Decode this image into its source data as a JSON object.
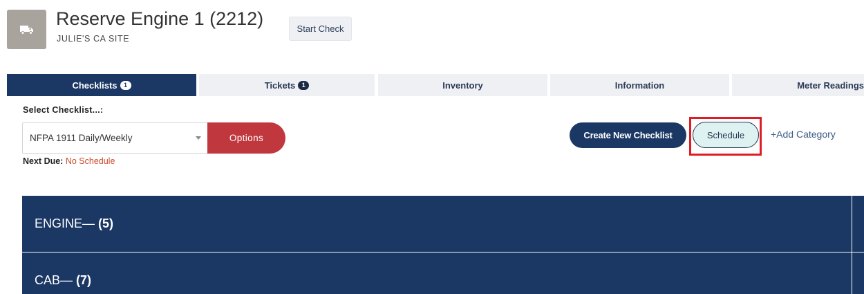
{
  "header": {
    "title": "Reserve Engine 1 (2212)",
    "subtitle": "JULIE'S CA SITE",
    "icon": "truck-icon",
    "start_check_label": "Start Check"
  },
  "tabs": [
    {
      "label": "Checklists",
      "badge": "1",
      "active": true
    },
    {
      "label": "Tickets",
      "badge": "1",
      "active": false
    },
    {
      "label": "Inventory",
      "active": false
    },
    {
      "label": "Information",
      "active": false
    },
    {
      "label": "Meter Readings",
      "active": false
    }
  ],
  "checklist": {
    "select_label": "Select Checklist...:",
    "selected_value": "NFPA 1911 Daily/Weekly",
    "options_label": "Options",
    "next_due_label": "Next Due:",
    "next_due_value": "No Schedule"
  },
  "actions": {
    "create_label": "Create New Checklist",
    "schedule_label": "Schedule",
    "add_category_label": "+Add Category"
  },
  "categories": [
    {
      "name": "ENGINE",
      "sep": " —",
      "count": "(5)"
    },
    {
      "name": "CAB",
      "sep": " —",
      "count": "(7)"
    }
  ],
  "colors": {
    "primary": "#1b3764",
    "danger": "#c0383d",
    "highlight": "#e01b24",
    "schedule_bg": "#def3f1",
    "next_due": "#c9492a"
  }
}
